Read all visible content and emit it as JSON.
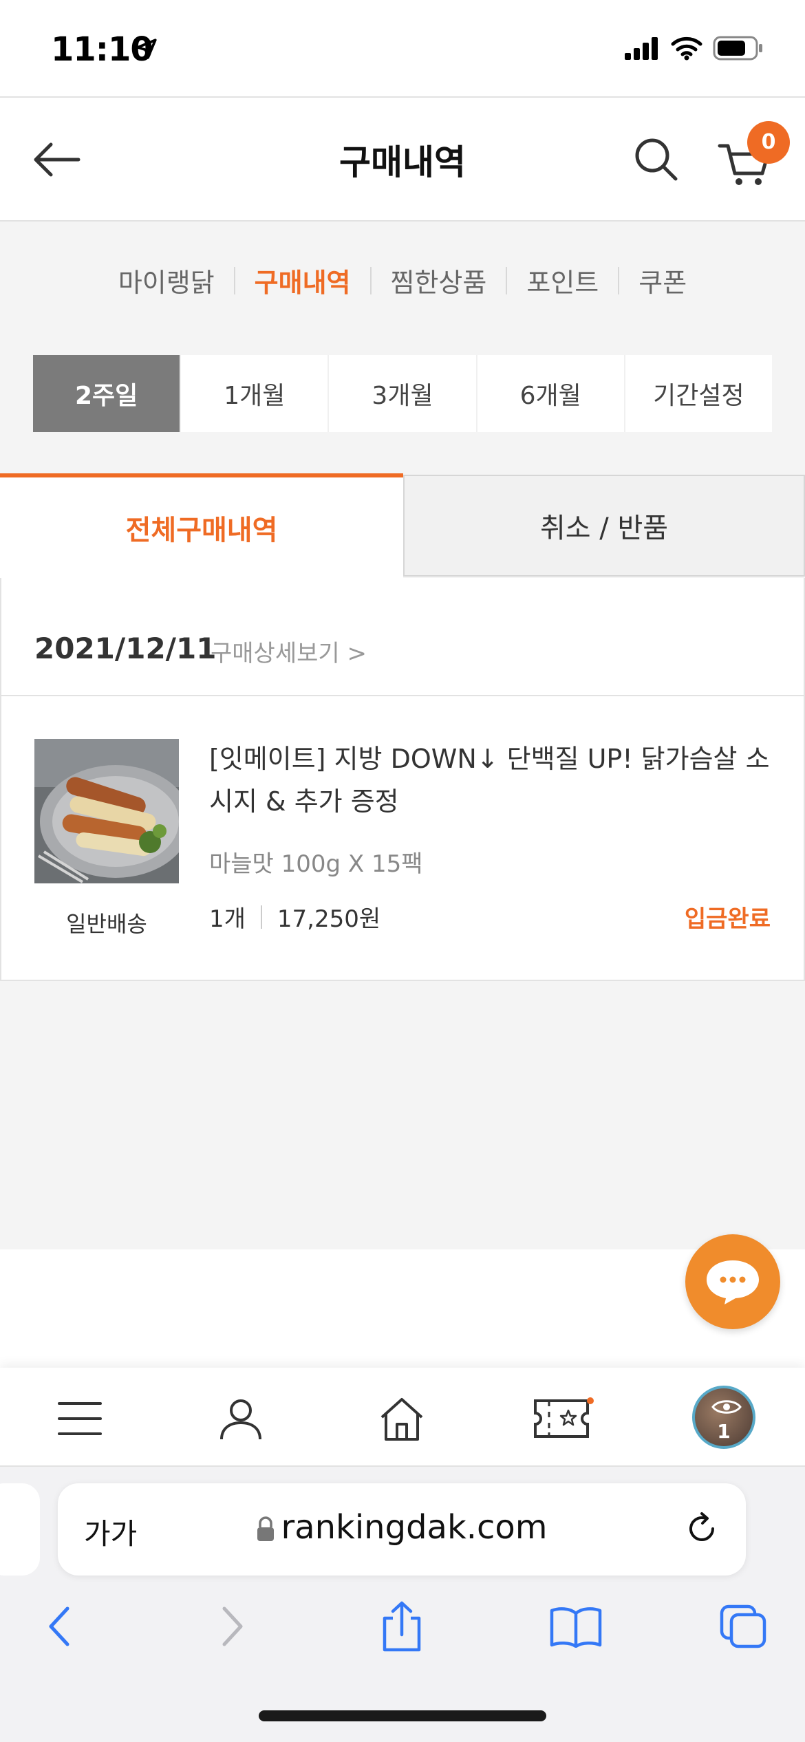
{
  "status_bar": {
    "time": "11:10"
  },
  "header": {
    "title": "구매내역",
    "cart_count": "0"
  },
  "submenu": {
    "items": [
      "마이랭닭",
      "구매내역",
      "찜한상품",
      "포인트",
      "쿠폰"
    ],
    "active": "구매내역"
  },
  "periods": {
    "options": [
      "2주일",
      "1개월",
      "3개월",
      "6개월",
      "기간설정"
    ],
    "selected": "2주일"
  },
  "order_tabs": {
    "all": "전체구매내역",
    "cancel": "취소 / 반품",
    "active": "전체구매내역"
  },
  "order": {
    "date": "2021/12/11",
    "detail_link": "구매상세보기 >",
    "shipping_type": "일반배송",
    "product": {
      "name": "[잇메이트] 지방 DOWN↓ 단백질 UP! 닭가슴살 소시지 & 추가 증정",
      "option": "마늘맛 100g X 15팩",
      "quantity": "1개",
      "price": "17,250원",
      "status": "입금완료"
    }
  },
  "bottom_nav": {
    "icons": [
      "menu-icon",
      "user-icon",
      "home-icon",
      "coupon-icon",
      "recent-viewed-icon"
    ],
    "recent_count": "1"
  },
  "safari": {
    "aa": "가가",
    "url": "rankingdak.com"
  },
  "colors": {
    "accent": "#ef6b24",
    "chat": "#f08c2c",
    "selected_period": "#7b7b7b"
  }
}
